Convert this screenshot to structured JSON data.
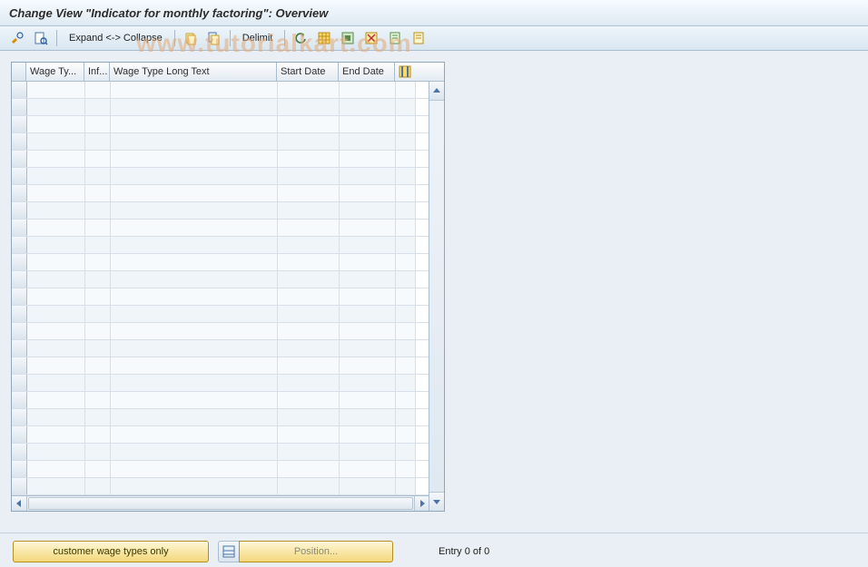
{
  "title": "Change View \"Indicator for monthly factoring\": Overview",
  "toolbar": {
    "expand_label": "Expand <-> Collapse",
    "delimit_label": "Delimit"
  },
  "table": {
    "columns": {
      "wage_type": "Wage Ty...",
      "inf": "Inf...",
      "wage_type_long": "Wage Type Long Text",
      "start_date": "Start Date",
      "end_date": "End Date"
    },
    "row_count": 24,
    "rows": []
  },
  "footer": {
    "customer_btn": "customer wage types only",
    "position_btn": "Position...",
    "status": "Entry 0 of 0"
  },
  "watermark": "www.tutorialkart.com",
  "icons": {
    "display_change": "display-change-icon",
    "other_view": "other-view-icon",
    "copy": "copy-icon",
    "copy2": "copy-icon",
    "undo": "undo-icon",
    "select_all": "select-all-icon",
    "select_block": "select-block-icon",
    "deselect": "deselect-icon",
    "config": "table-settings-icon"
  }
}
